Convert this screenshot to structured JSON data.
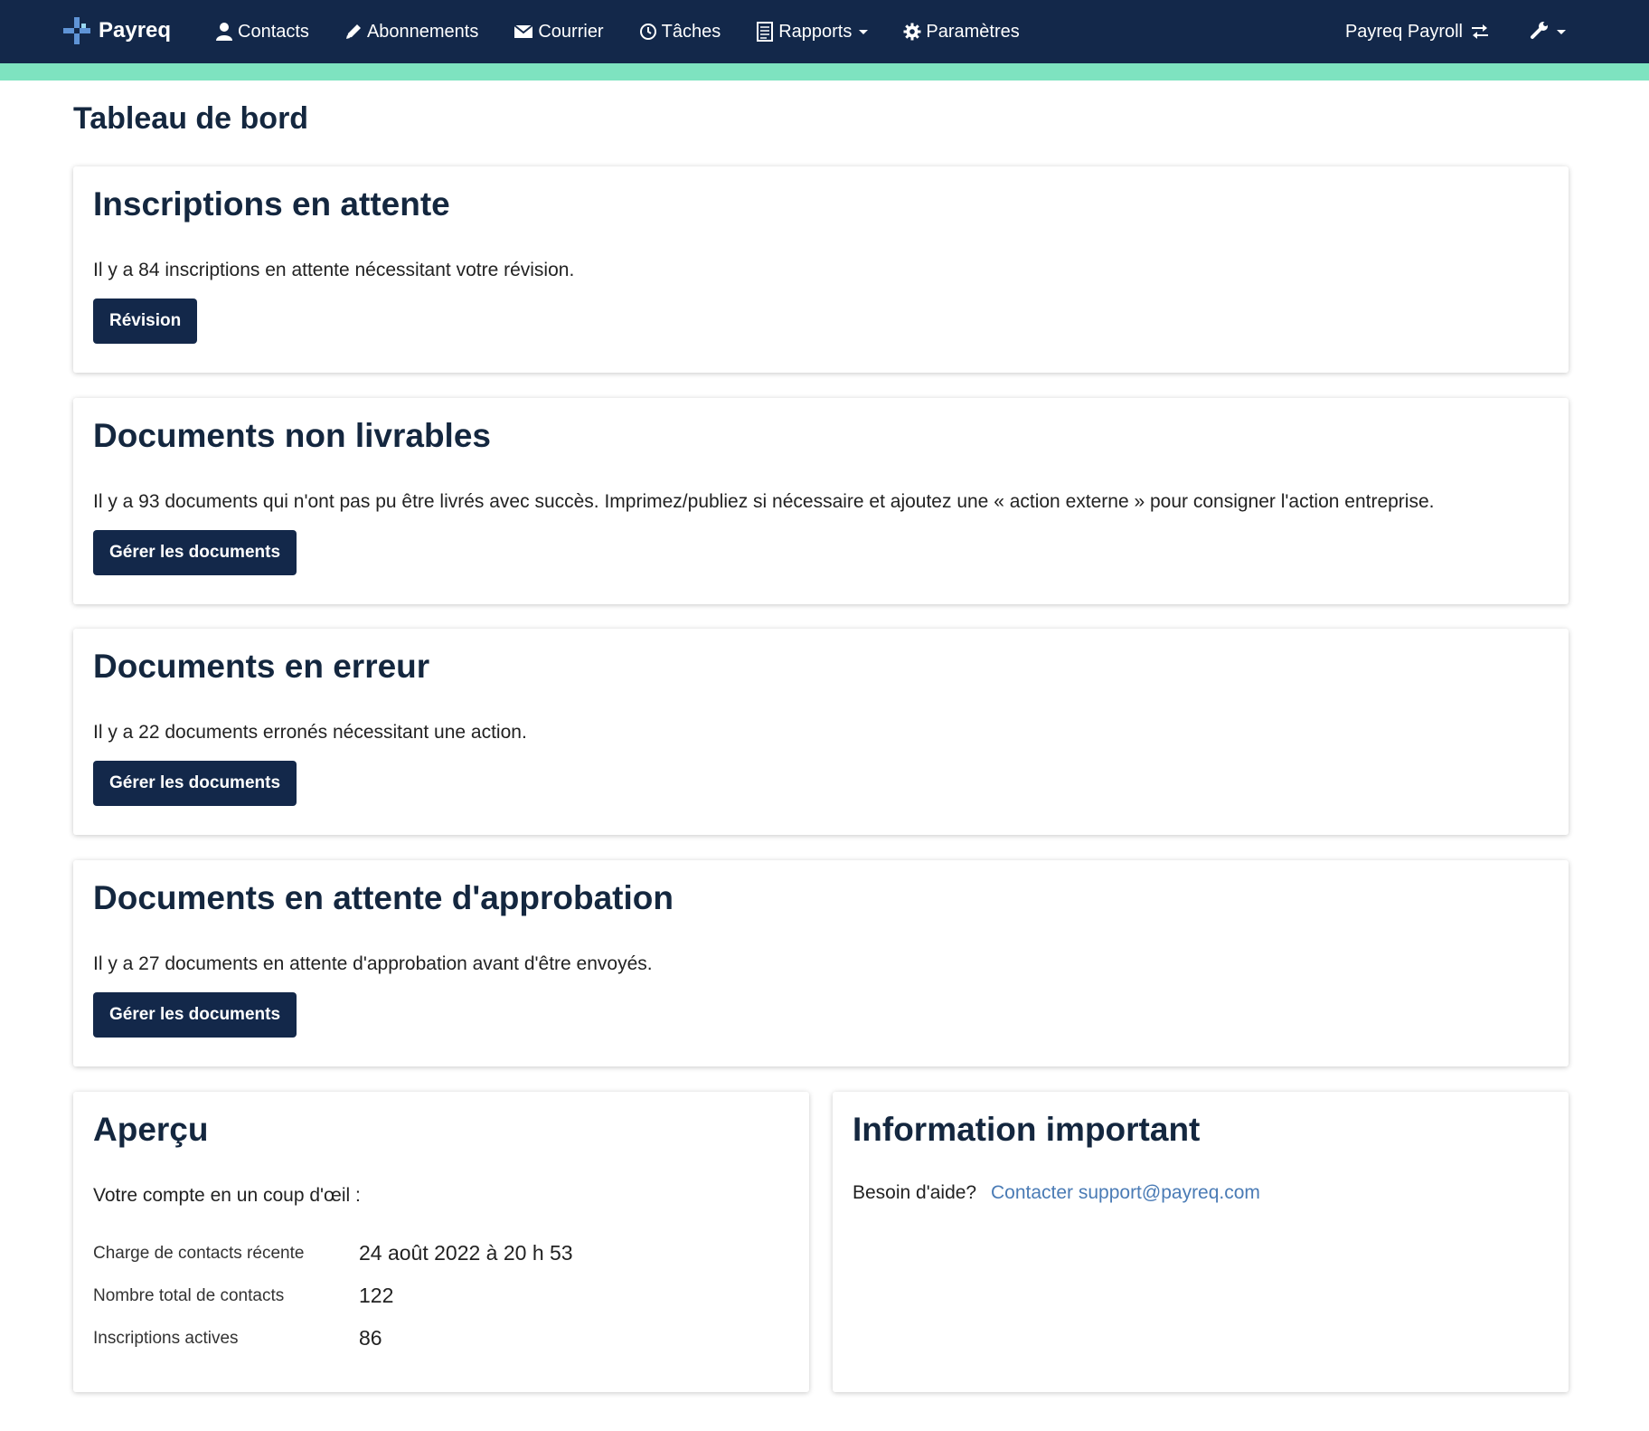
{
  "navbar": {
    "brand": "Payreq",
    "items": [
      {
        "label": "Contacts",
        "icon": "user-icon"
      },
      {
        "label": "Abonnements",
        "icon": "pencil-icon"
      },
      {
        "label": "Courrier",
        "icon": "envelope-icon"
      },
      {
        "label": "Tâches",
        "icon": "clock-icon"
      },
      {
        "label": "Rapports",
        "icon": "report-icon",
        "dropdown": true
      },
      {
        "label": "Paramètres",
        "icon": "gear-icon"
      }
    ],
    "tenant": "Payreq Payroll",
    "colors": {
      "background": "#13284a",
      "accent_strip": "#7ee3c0"
    }
  },
  "page": {
    "title": "Tableau de bord"
  },
  "cards": [
    {
      "title": "Inscriptions en attente",
      "text": "Il y a 84 inscriptions en attente nécessitant votre révision.",
      "button": "Révision"
    },
    {
      "title": "Documents non livrables",
      "text": "Il y a 93 documents qui n'ont pas pu être livrés avec succès. Imprimez/publiez si nécessaire et ajoutez une « action externe » pour consigner l'action entreprise.",
      "button": "Gérer les documents"
    },
    {
      "title": "Documents en erreur",
      "text": "Il y a 22 documents erronés nécessitant une action.",
      "button": "Gérer les documents"
    },
    {
      "title": "Documents en attente d'approbation",
      "text": "Il y a 27 documents en attente d'approbation avant d'être envoyés.",
      "button": "Gérer les documents"
    }
  ],
  "overview": {
    "title": "Aperçu",
    "intro": "Votre compte en un coup d'œil :",
    "rows": [
      {
        "label": "Charge de contacts récente",
        "value": "24 août 2022 à 20 h 53"
      },
      {
        "label": "Nombre total de contacts",
        "value": "122"
      },
      {
        "label": "Inscriptions actives",
        "value": "86"
      }
    ]
  },
  "info": {
    "title": "Information important",
    "help_text": "Besoin d'aide?",
    "link_text": "Contacter support@payreq.com",
    "link_color": "#4a7bb5"
  }
}
